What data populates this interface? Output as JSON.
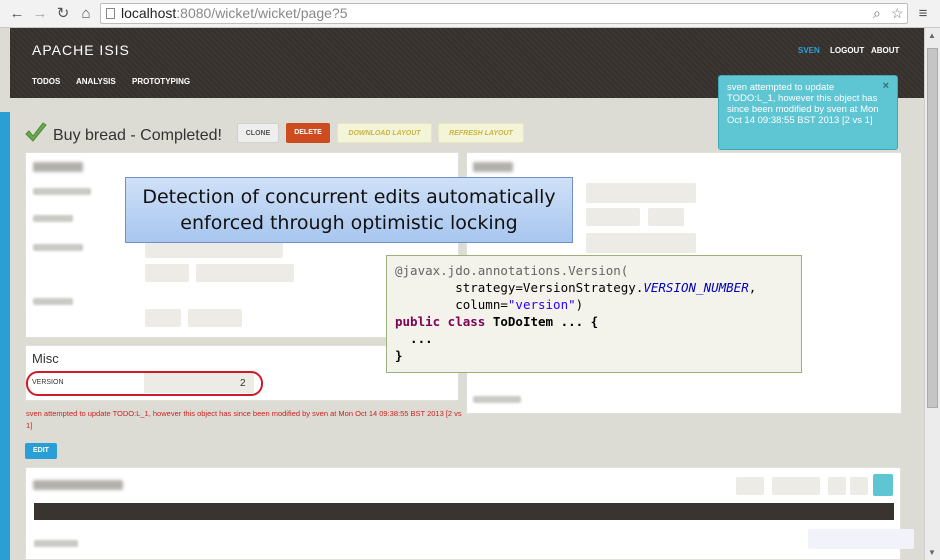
{
  "browser": {
    "url_host": "localhost",
    "url_rest": ":8080/wicket/wicket/page?5"
  },
  "header": {
    "brand": "APACHE ISIS",
    "menu": [
      "TODOS",
      "ANALYSIS",
      "PROTOTYPING"
    ],
    "user": "SVEN",
    "logout": "LOGOUT",
    "about": "ABOUT"
  },
  "entity": {
    "title": "Buy bread - Completed!",
    "actions": {
      "clone": "CLONE",
      "delete": "DELETE",
      "download": "DOWNLOAD LAYOUT",
      "refresh": "REFRESH LAYOUT"
    }
  },
  "misc": {
    "title": "Misc",
    "version_label": "VERSION",
    "version_value": "2"
  },
  "error_message": "sven attempted to update TODO:L_1, however this object has since been modified by sven at Mon Oct 14 09:38:55 BST 2013 [2 vs 1]",
  "edit_label": "EDIT",
  "notification": {
    "text": "sven attempted to update TODO:L_1, however this object has since been modified by sven at Mon Oct 14 09:38:55 BST 2013 [2 vs 1]",
    "close": "×"
  },
  "callout": {
    "line1": "Detection of concurrent edits automatically",
    "line2": "enforced through optimistic locking"
  },
  "code": {
    "line1_annotation": "@javax.jdo.annotations.",
    "line1_name": "Version(",
    "line2_prefix": "        strategy=VersionStrategy.",
    "line2_const": "VERSION_NUMBER",
    "line2_suffix": ",",
    "line3_prefix": "        column=",
    "line3_string": "\"version\"",
    "line3_suffix": ")",
    "line4_kw": "public class",
    "line4_rest": " ToDoItem ... {",
    "line5": "  ...",
    "line6": "}"
  },
  "colors": {
    "accent": "#2a9fd6",
    "danger": "#cc4b1f",
    "notify": "#5ec5d2"
  }
}
